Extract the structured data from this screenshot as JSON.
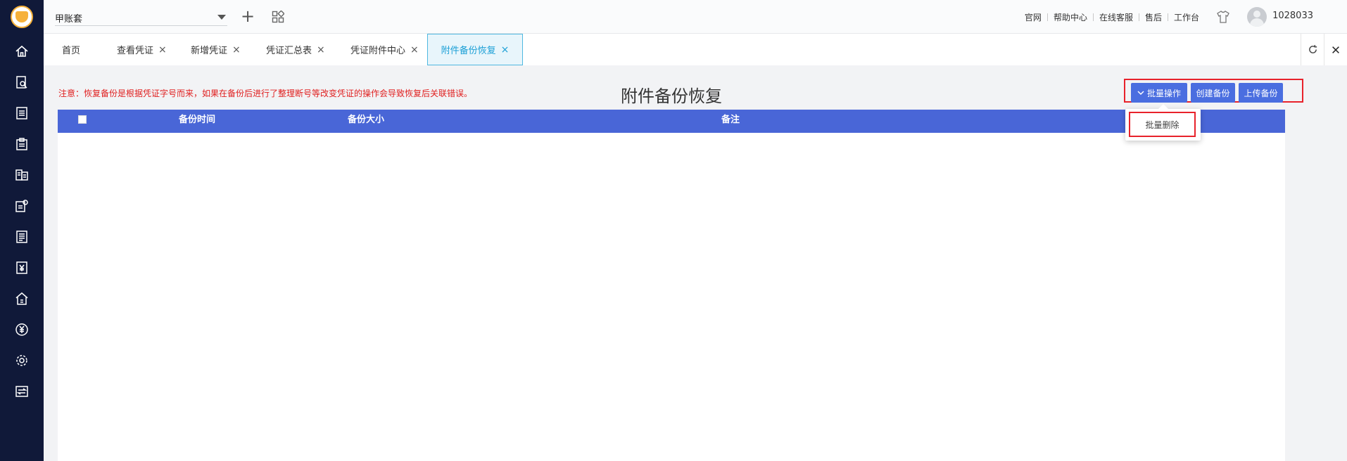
{
  "app": {
    "account_book": "甲账套",
    "user_id": "1028033"
  },
  "top_links": [
    "官网",
    "帮助中心",
    "在线客服",
    "售后",
    "工作台"
  ],
  "sidebar": {
    "icons": [
      "home-icon",
      "voucher-search-icon",
      "ledger-icon",
      "clipboard-icon",
      "book-icon",
      "report-settings-icon",
      "list-icon",
      "yen-document-icon",
      "building-icon",
      "yen-circle-icon",
      "settings-icon",
      "transfer-icon"
    ]
  },
  "tabs": [
    {
      "label": "首页",
      "closable": false
    },
    {
      "label": "查看凭证",
      "closable": true
    },
    {
      "label": "新增凭证",
      "closable": true
    },
    {
      "label": "凭证汇总表",
      "closable": true
    },
    {
      "label": "凭证附件中心",
      "closable": true
    },
    {
      "label": "附件备份恢复",
      "closable": true,
      "active": true
    }
  ],
  "tab_close_glyph": "×",
  "page": {
    "title": "附件备份恢复",
    "notice": "注意：恢复备份是根据凭证字号而来，如果在备份后进行了整理断号等改变凭证的操作会导致恢复后关联错误。",
    "buttons": {
      "batch": "批量操作",
      "create_backup": "创建备份",
      "upload_backup": "上传备份"
    },
    "dropdown": {
      "items": [
        "批量删除"
      ]
    },
    "table": {
      "columns": [
        "备份时间",
        "备份大小",
        "备注"
      ],
      "rows": []
    }
  },
  "colors": {
    "sidebar_bg": "#101939",
    "table_header_bg": "#4966d7",
    "button_bg": "#4a6ee0",
    "notice_text": "#e02020",
    "highlight_border": "#e8222b",
    "active_tab_text": "#1a9fd6"
  }
}
